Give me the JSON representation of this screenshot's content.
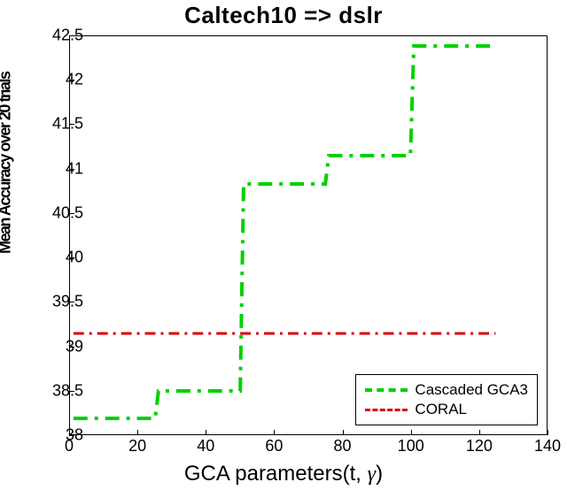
{
  "title": "Caltech10 => dslr",
  "ylabel": "Mean Accuracy over 20 trials",
  "xlabel_prefix": "GCA parameters(t,",
  "xlabel_gamma": "γ",
  "xlabel_suffix": ")",
  "legend": {
    "series1": "Cascaded GCA3",
    "series2": "CORAL"
  },
  "axes": {
    "xmin": 0,
    "xmax": 140,
    "ymin": 38,
    "ymax": 42.5,
    "xticks": [
      0,
      20,
      40,
      60,
      80,
      100,
      120,
      140
    ],
    "yticks": [
      38,
      38.5,
      39,
      39.5,
      40,
      40.5,
      41,
      41.5,
      42,
      42.5
    ]
  },
  "chart_data": {
    "type": "line",
    "title": "Caltech10 => dslr",
    "xlabel": "GCA parameters(t, γ)",
    "ylabel": "Mean Accuracy over 20 trials",
    "xlim": [
      0,
      140
    ],
    "ylim": [
      38,
      42.5
    ],
    "x": [
      1,
      25,
      26,
      50,
      51,
      75,
      76,
      100,
      101,
      125
    ],
    "series": [
      {
        "name": "Cascaded GCA3",
        "color": "#00d000",
        "style": "dash-dot",
        "values": [
          38.18,
          38.18,
          38.49,
          38.49,
          40.83,
          40.83,
          41.15,
          41.15,
          42.39,
          42.39
        ]
      },
      {
        "name": "CORAL",
        "color": "#d80000",
        "style": "dash-dot",
        "values": [
          39.14,
          39.14,
          39.14,
          39.14,
          39.14,
          39.14,
          39.14,
          39.14,
          39.14,
          39.14
        ]
      }
    ]
  }
}
